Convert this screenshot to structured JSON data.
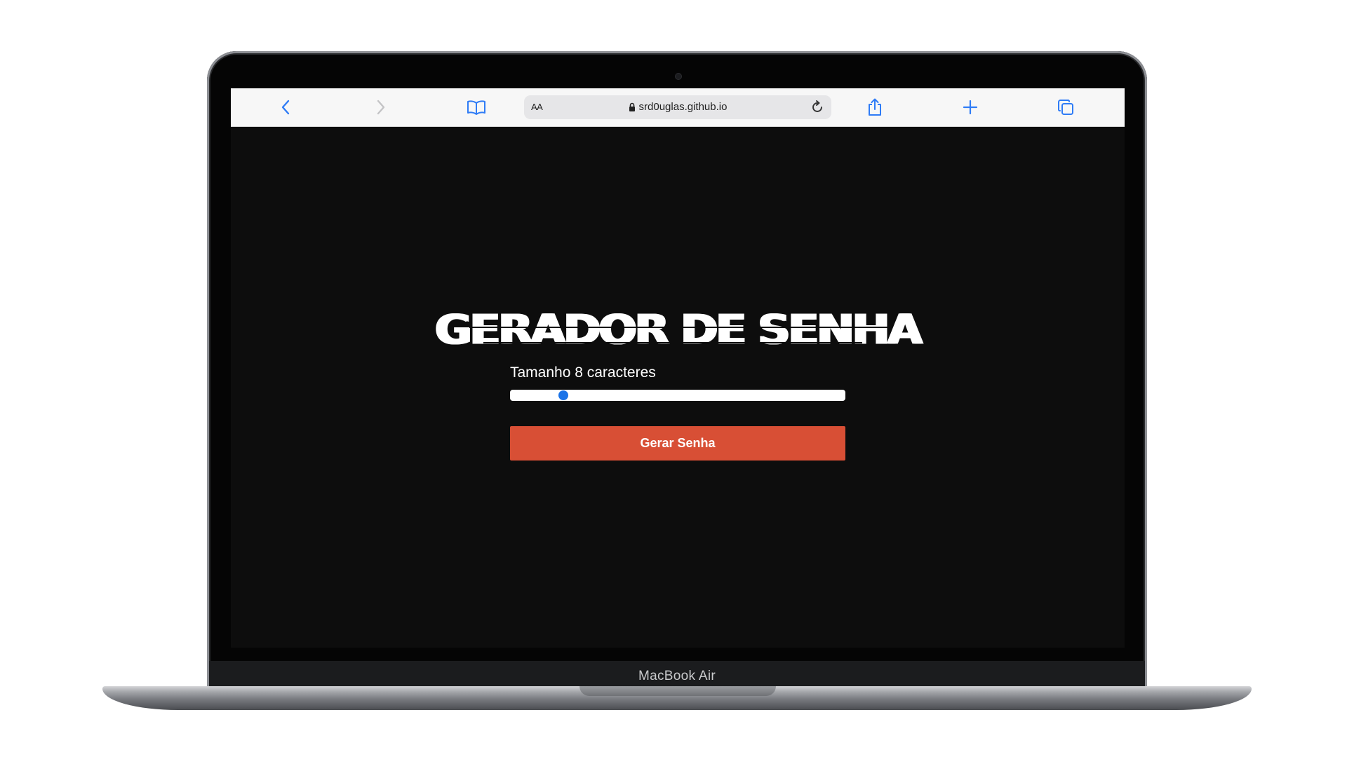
{
  "device": {
    "label": "MacBook Air"
  },
  "browser": {
    "text_size_button": "AA",
    "url": "srd0uglas.github.io",
    "icons": {
      "back": "chevron-left-icon",
      "forward": "chevron-right-icon",
      "bookmarks": "book-icon",
      "lock": "lock-icon",
      "reload": "reload-icon",
      "share": "share-icon",
      "new_tab": "plus-icon",
      "tabs": "tabs-icon"
    },
    "accent_color": "#2f7cf6"
  },
  "page": {
    "title": "GERADOR DE SENHA",
    "length_label": "Tamanho 8 caracteres",
    "slider": {
      "value_fraction": 0.16
    },
    "generate_button": "Gerar Senha",
    "colors": {
      "background": "#0d0d0d",
      "button": "#d84f35",
      "slider_thumb": "#1a73e8"
    }
  }
}
